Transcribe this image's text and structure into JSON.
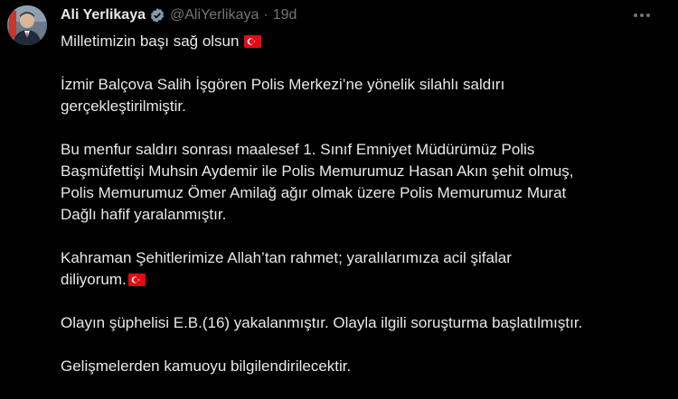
{
  "author": {
    "name": "Ali Yerlikaya",
    "handle": "@AliYerlikaya",
    "time": "19d"
  },
  "tweet": {
    "line1": "Milletimizin başı sağ olsun",
    "p2": "İzmir Balçova Salih İşgören Polis Merkezi’ne yönelik silahlı saldırı\ngerçekleştirilmiştir.",
    "p3": "Bu menfur saldırı sonrası maalesef 1. Sınıf Emniyet Müdürümüz Polis\nBaşmüfettişi Muhsin Aydemir ile Polis Memurumuz Hasan Akın şehit olmuş,\nPolis Memurumuz Ömer Amilağ ağır olmak üzere Polis Memurumuz Murat\nDağlı hafif yaralanmıştır.",
    "p4a": "Kahraman Şehitlerimize Allah’tan rahmet; yaralılarımıza acil şifalar",
    "p4b": "diliyorum.",
    "p5": "Olayın şüphelisi E.B.(16) yakalanmıştır. Olayla ilgili soruşturma başlatılmıştır.",
    "p6": "Gelişmelerden kamuoyu bilgilendirilecektir."
  },
  "icons": {
    "verified": "verified-badge-icon",
    "more": "more-options-icon",
    "flag": "turkey-flag-icon"
  },
  "colors": {
    "background": "#000000",
    "text": "#e7e9ea",
    "muted": "#71767b",
    "flag_red": "#e30a17"
  }
}
